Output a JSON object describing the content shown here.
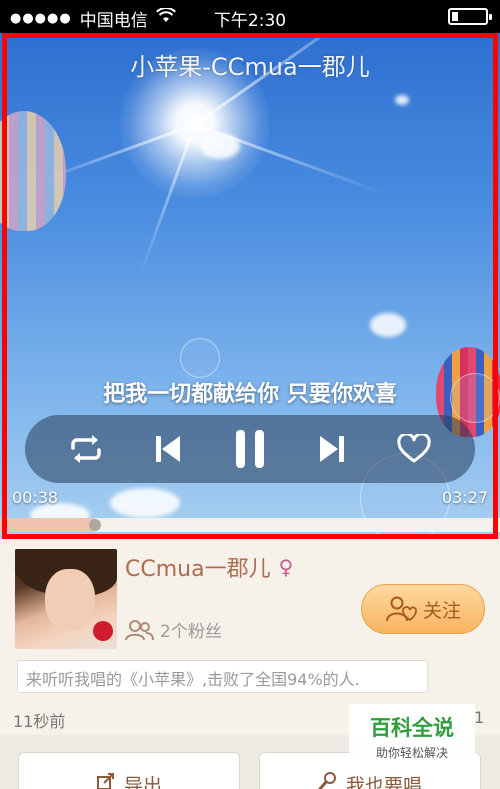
{
  "statusbar": {
    "signal_dots": "●●●●●",
    "carrier": "中国电信",
    "time": "下午2:30",
    "battery_level": 0.2
  },
  "player": {
    "title": "小苹果-CCmua一郡儿",
    "lyric": "把我一切都献给你 只要你欢喜",
    "time_current": "00:38",
    "time_total": "03:27",
    "progress": 0.19,
    "controls": {
      "repeat_icon": "repeat-icon",
      "prev_icon": "skip-previous-icon",
      "pause_icon": "pause-icon",
      "next_icon": "skip-next-icon",
      "like_icon": "heart-icon"
    },
    "highlight_color": "#ff0000"
  },
  "profile": {
    "username": "CCmua一郡儿",
    "gender_symbol": "♀",
    "fans": "2个粉丝",
    "follow_label": "关注",
    "message": "来听听我唱的《小苹果》,击败了全国94%的人.",
    "timestamp": "11秒前",
    "side_count": "1"
  },
  "actions": {
    "export_label": "导出",
    "sing_label": "我也要唱"
  },
  "watermark": {
    "title": "百科全说",
    "subtitle": "助你轻松解决"
  },
  "colors": {
    "username": "#b06a52",
    "follow_button": "#f7b45f",
    "watermark_green": "#2e9e3e"
  }
}
